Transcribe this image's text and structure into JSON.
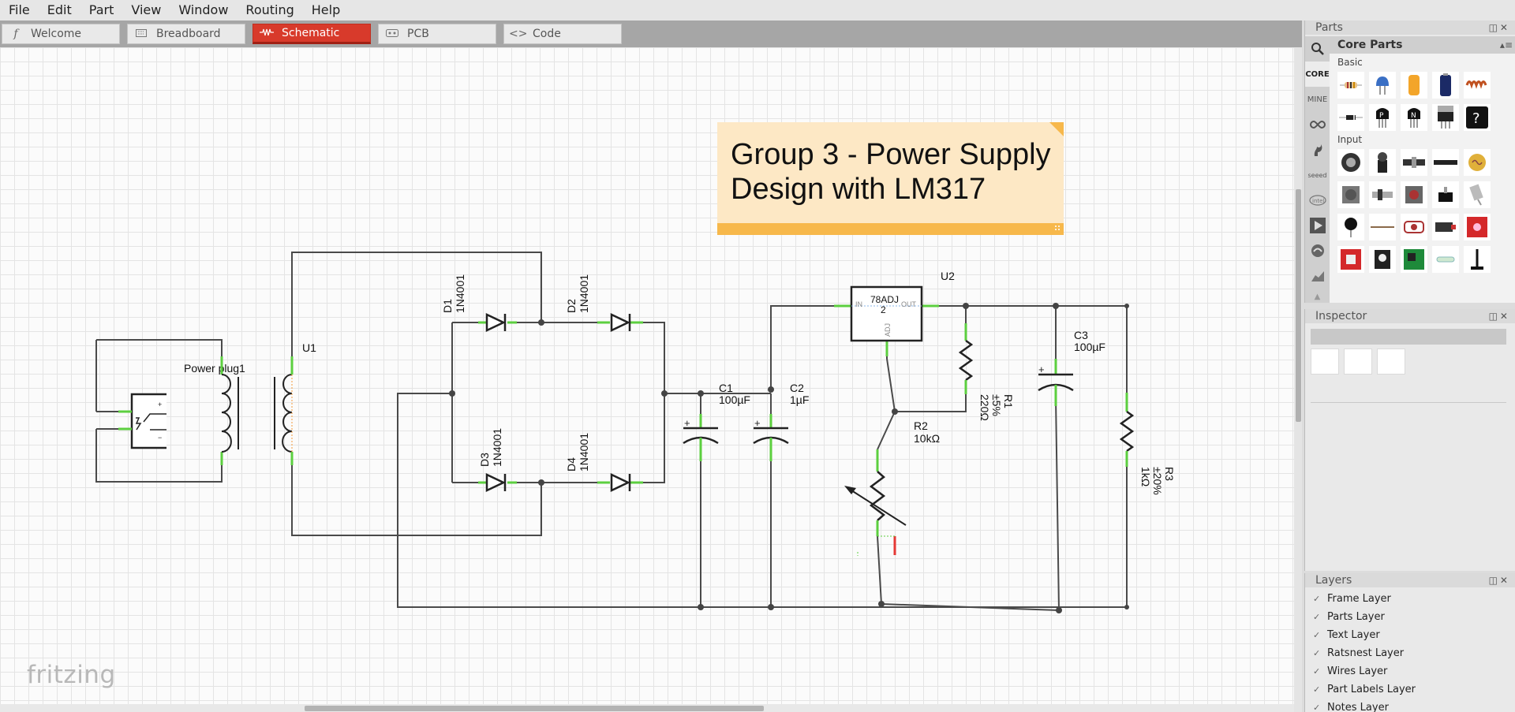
{
  "menu": [
    "File",
    "Edit",
    "Part",
    "View",
    "Window",
    "Routing",
    "Help"
  ],
  "tabs": [
    {
      "label": "Welcome",
      "icon": "fritzing-f-icon"
    },
    {
      "label": "Breadboard",
      "icon": "breadboard-icon"
    },
    {
      "label": "Schematic",
      "icon": "resistor-icon",
      "active": true
    },
    {
      "label": "PCB",
      "icon": "pcb-icon"
    },
    {
      "label": "Code",
      "icon": "code-icon"
    }
  ],
  "canvas": {
    "logo": "fritzing",
    "note": {
      "line1": "Group 3 - Power Supply",
      "line2": "Design with LM317"
    },
    "labels": {
      "power_plug": "Power plug1",
      "u1": "U1",
      "d1": "D1",
      "d1_value": "1N4001",
      "d2": "D2",
      "d2_value": "1N4001",
      "d3": "D3",
      "d3_value": "1N4001",
      "d4": "D4",
      "d4_value": "1N4001",
      "c1": "C1",
      "c1_value": "100µF",
      "c2": "C2",
      "c2_value": "1µF",
      "c3": "C3",
      "c3_value": "100µF",
      "u2": "U2",
      "reg_name": "78ADJ",
      "reg_num": "2",
      "reg_in": "IN",
      "reg_out": "OUT",
      "reg_adj": "ADJ",
      "r1": "R1",
      "r1_tol": "±5%",
      "r1_value": "220Ω",
      "r2": "R2",
      "r2_value": "10kΩ",
      "r3": "R3",
      "r3_tol": "±20%",
      "r3_value": "1kΩ"
    }
  },
  "parts_panel": {
    "title": "Parts",
    "bin": "Core Parts",
    "sidebar": [
      "search-icon",
      "CORE",
      "MINE",
      "arduino-icon",
      "sparkfun-icon",
      "seeed-icon",
      "intel-icon",
      "play-icon",
      "snootlab-icon",
      "chart-icon",
      "arrow-up-icon",
      "arrow-down-icon"
    ],
    "categories": [
      {
        "name": "Basic",
        "items": [
          "resistor",
          "ceramic-capacitor",
          "electrolytic-capacitor-yellow",
          "battery",
          "inductor",
          "diode",
          "pnp-transistor",
          "npn-transistor",
          "voltage-regulator",
          "mystery-part"
        ]
      },
      {
        "name": "Input",
        "items": [
          "potentiometer-rotary",
          "joystick",
          "slide-potentiometer",
          "header",
          "light-sensor",
          "rotary-encoder",
          "slide-switch",
          "pushbutton",
          "toggle-switch",
          "tilt-switch",
          "microphone",
          "antenna",
          "fsr",
          "temp-sensor",
          "sparkfun-board",
          "sparkfun-board-2",
          "sensor-module",
          "green-board",
          "reed-switch",
          "knob-stand"
        ]
      }
    ]
  },
  "inspector": {
    "title": "Inspector"
  },
  "layers": {
    "title": "Layers",
    "items": [
      "Frame Layer",
      "Parts Layer",
      "Text Layer",
      "Ratsnest Layer",
      "Wires Layer",
      "Part Labels Layer",
      "Notes Layer"
    ]
  },
  "colors": {
    "accent": "#d83a2b",
    "note_bg": "#fde8c5",
    "note_bar": "#f7b84b",
    "wire": "#4a4a4a",
    "pin": "#5ccf3f"
  }
}
